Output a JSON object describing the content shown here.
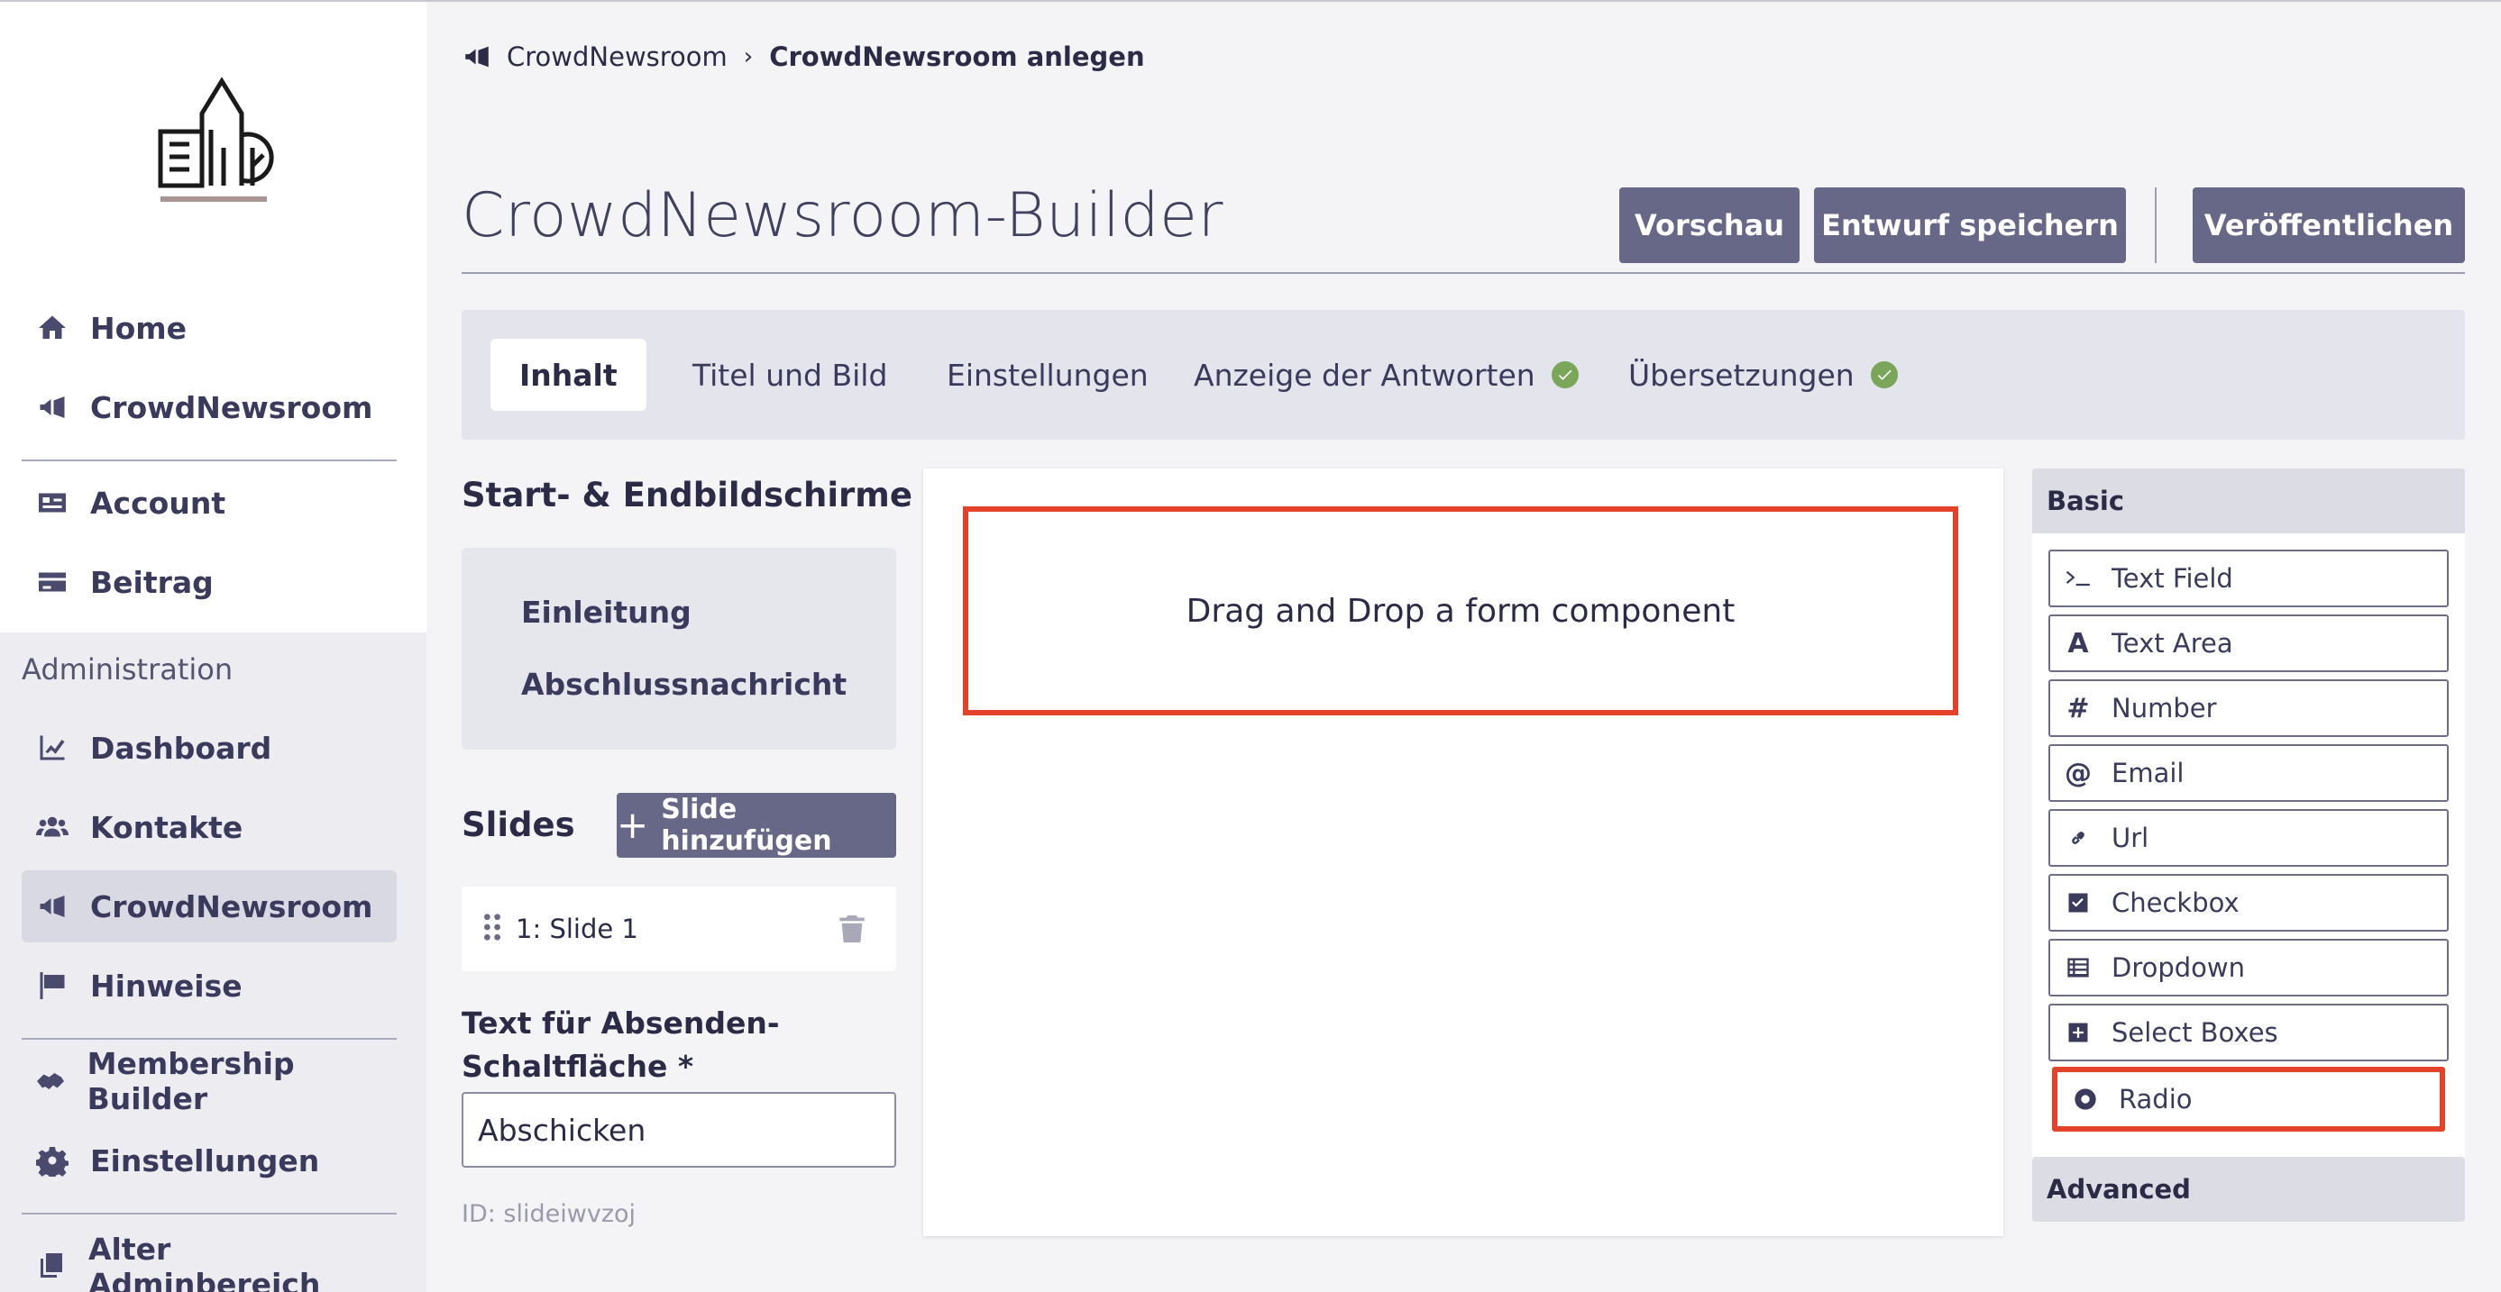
{
  "breadcrumb": {
    "parent": "CrowdNewsroom",
    "separator": "›",
    "current": "CrowdNewsroom anlegen"
  },
  "header": {
    "title": "CrowdNewsroom-Builder",
    "preview_label": "Vorschau",
    "save_draft_label": "Entwurf speichern",
    "publish_label": "Veröffentlichen"
  },
  "sidebar": {
    "items": [
      {
        "label": "Home",
        "icon": "home-icon"
      },
      {
        "label": "CrowdNewsroom",
        "icon": "megaphone-icon"
      },
      {
        "label": "Account",
        "icon": "id-card-icon"
      },
      {
        "label": "Beitrag",
        "icon": "credit-card-icon"
      }
    ],
    "admin_heading": "Administration",
    "admin_items": [
      {
        "label": "Dashboard",
        "icon": "chart-line-icon"
      },
      {
        "label": "Kontakte",
        "icon": "users-icon"
      },
      {
        "label": "CrowdNewsroom",
        "icon": "megaphone-icon",
        "active": true
      },
      {
        "label": "Hinweise",
        "icon": "flag-icon"
      },
      {
        "label": "Membership Builder",
        "icon": "handshake-icon"
      },
      {
        "label": "Einstellungen",
        "icon": "gear-icon"
      },
      {
        "label": "Alter Adminbereich",
        "icon": "copy-icon"
      }
    ]
  },
  "tabs": [
    {
      "label": "Inhalt",
      "active": true
    },
    {
      "label": "Titel und Bild"
    },
    {
      "label": "Einstellungen"
    },
    {
      "label": "Anzeige der Antworten",
      "complete": true
    },
    {
      "label": "Übersetzungen",
      "complete": true
    }
  ],
  "left_panel": {
    "screens_title": "Start- & Endbildschirme",
    "screens": [
      "Einleitung",
      "Abschlussnachricht"
    ],
    "slides_title": "Slides",
    "add_slide_label": "Slide hinzufügen",
    "slides": [
      "1: Slide 1"
    ],
    "submit_label_title": "Text für Absenden-",
    "submit_label_title2": "Schaltfläche *",
    "submit_value": "Abschicken",
    "slide_id": "ID: slideiwvzoj"
  },
  "canvas": {
    "dropzone_text": "Drag and Drop a form component"
  },
  "palette": {
    "basic_label": "Basic",
    "advanced_label": "Advanced",
    "components": [
      {
        "label": "Text Field",
        "icon": "terminal-icon"
      },
      {
        "label": "Text Area",
        "icon": "font-icon"
      },
      {
        "label": "Number",
        "icon": "hashtag-icon"
      },
      {
        "label": "Email",
        "icon": "at-icon"
      },
      {
        "label": "Url",
        "icon": "link-icon"
      },
      {
        "label": "Checkbox",
        "icon": "check-square-icon"
      },
      {
        "label": "Dropdown",
        "icon": "list-icon"
      },
      {
        "label": "Select Boxes",
        "icon": "plus-square-icon"
      },
      {
        "label": "Radio",
        "icon": "dot-circle-icon",
        "highlighted": true
      }
    ]
  },
  "colors": {
    "accent": "#676787",
    "highlight": "#e2432a",
    "success": "#7aa65a"
  }
}
